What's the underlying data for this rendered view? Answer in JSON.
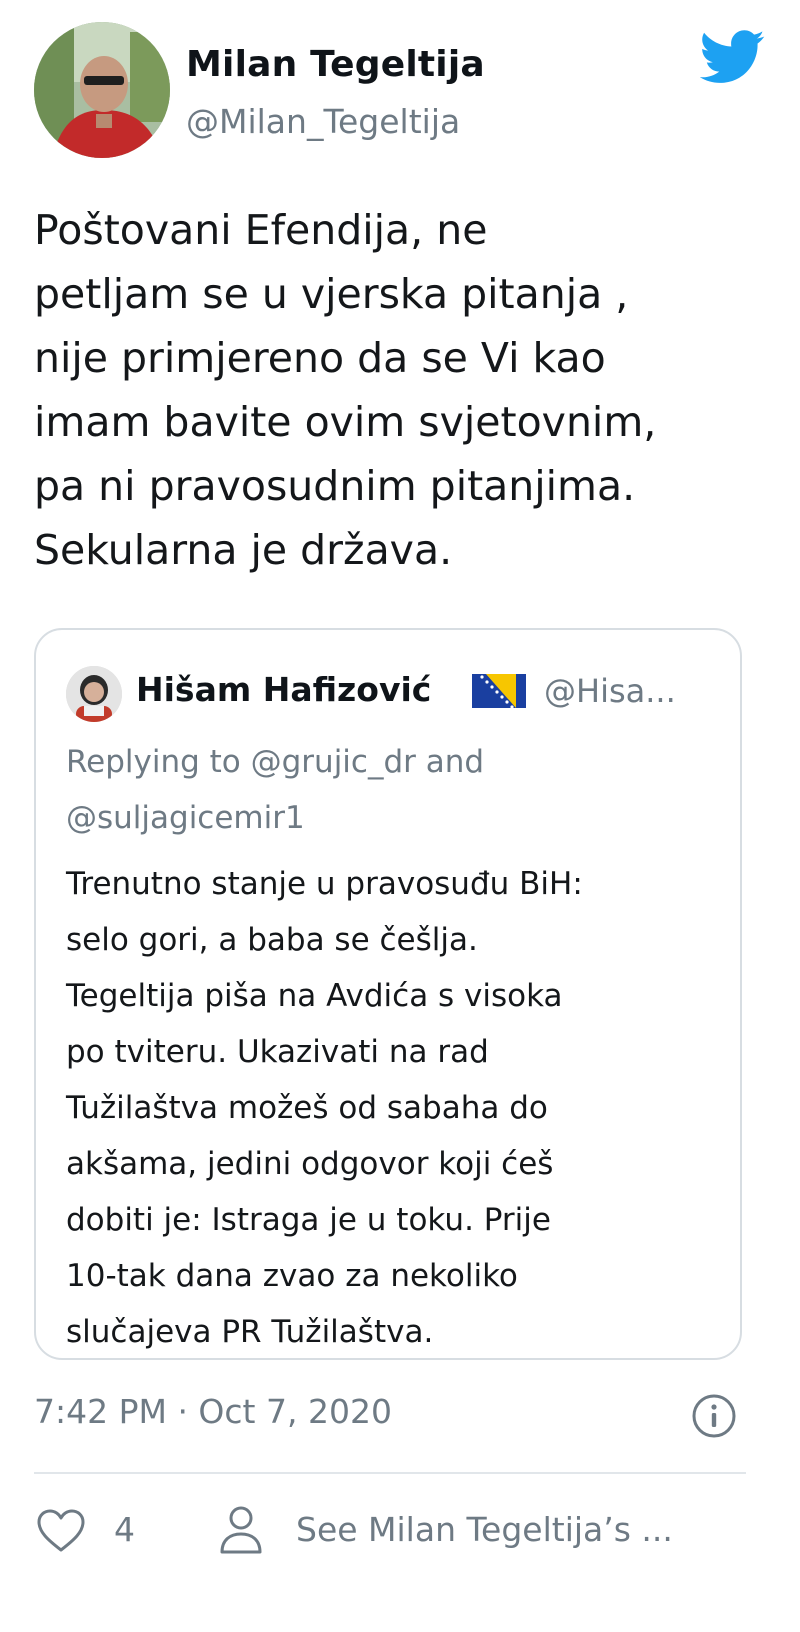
{
  "tweet": {
    "author": {
      "name": "Milan Tegeltija",
      "handle": "@Milan_Tegeltija",
      "avatar": "profile-photo"
    },
    "brand_icon": "twitter-bird-icon",
    "brand_color": "#1da1f2",
    "text_lines": [
      "Poštovani Efendija, ne",
      "petljam se u vjerska pitanja ,",
      "nije primjereno da se Vi kao",
      "imam bavite ovim svjetovnim,",
      "pa ni pravosudnim pitanjima.",
      "Sekularna je država."
    ],
    "quoted": {
      "name": "Hišam Hafizović",
      "handle": "@Hisa...",
      "flag": "bosnia-herzegovina-flag-icon",
      "reply_lines": [
        "Replying to @grujic_dr and",
        "@suljagicemir1"
      ],
      "text_lines": [
        "Trenutno stanje u pravosuđu BiH:",
        "selo gori, a baba se češlja.",
        "Tegeltija piša na Avdića s visoka",
        "po tviteru. Ukazivati na rad",
        "Tužilaštva možeš od sabaha do",
        "akšama, jedini odgovor koji ćeš",
        "dobiti je: Istraga je u toku. Prije",
        "10-tak dana zvao za nekoliko",
        "slučajeva PR Tužilaštva."
      ]
    },
    "timestamp": "7:42 PM · Oct 7, 2020",
    "info_icon": "info-icon",
    "footer": {
      "like_count": "4",
      "see_profile": "See Milan Tegeltija’s ..."
    },
    "colors": {
      "text": "#14171a",
      "muted": "#6e7a84",
      "border": "#d7dde2"
    }
  }
}
